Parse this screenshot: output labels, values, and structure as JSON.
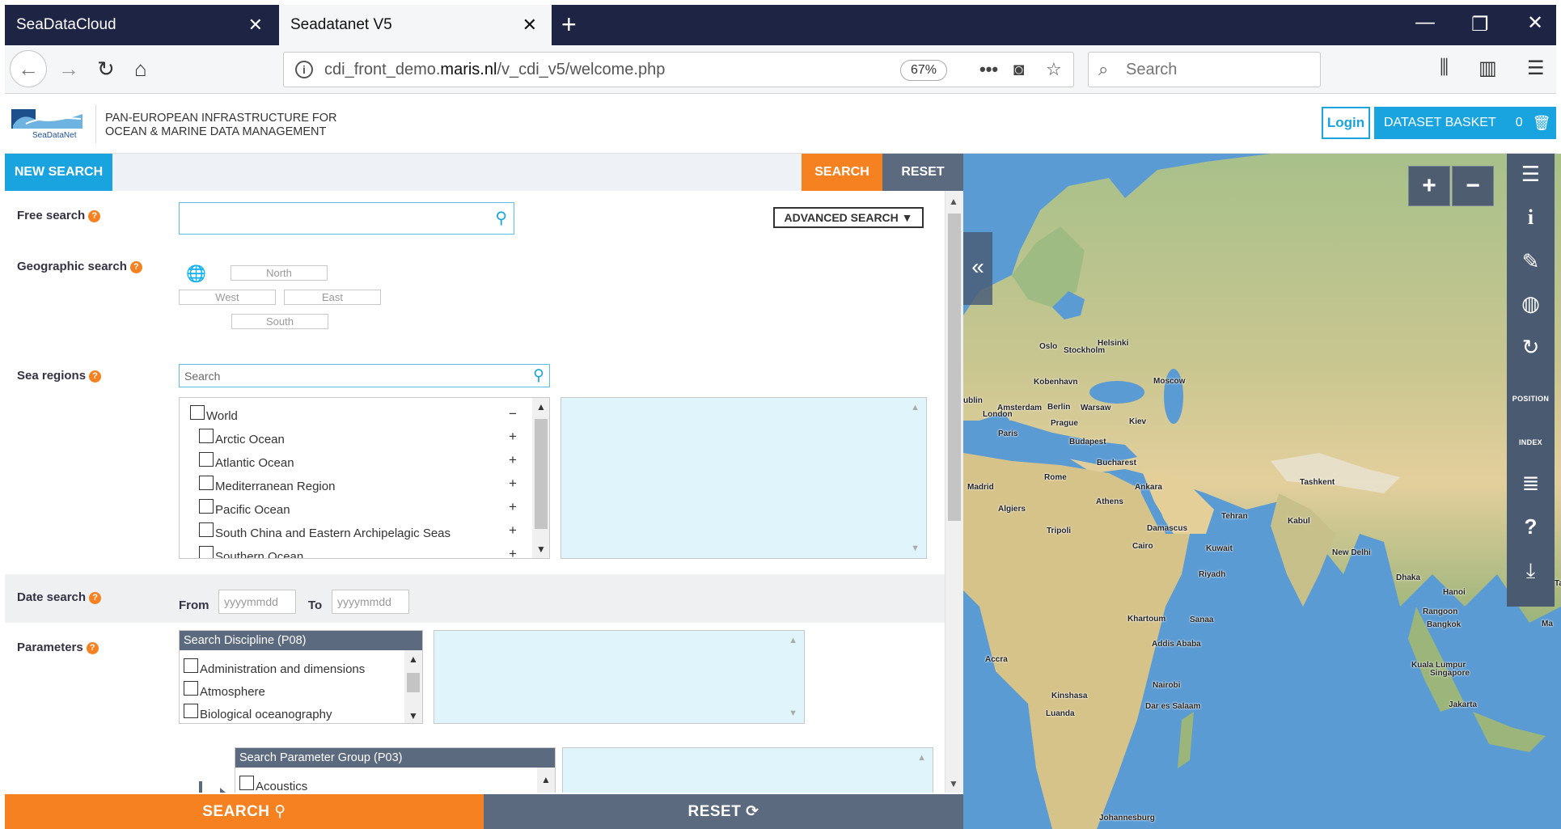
{
  "browser": {
    "tabs": [
      {
        "title": "SeaDataCloud"
      },
      {
        "title": "Seadatanet V5"
      }
    ],
    "url_prefix": "cdi_front_demo.",
    "url_domain": "maris.nl",
    "url_path": "/v_cdi_v5/welcome.php",
    "zoom": "67%",
    "search_placeholder": "Search"
  },
  "header": {
    "logo_text": "SeaDataNet",
    "tagline_line1": "PAN-EUROPEAN INFRASTRUCTURE FOR",
    "tagline_line2": "OCEAN & MARINE DATA MANAGEMENT",
    "login_label": "Login",
    "basket_label": "DATASET BASKET",
    "basket_count": "0"
  },
  "toolbar": {
    "new_search": "NEW SEARCH",
    "search": "SEARCH",
    "reset": "RESET"
  },
  "form": {
    "free_search_label": "Free search",
    "advanced_search": "ADVANCED SEARCH ▼",
    "geo_label": "Geographic search",
    "geo_north": "North",
    "geo_west": "West",
    "geo_east": "East",
    "geo_south": "South",
    "sea_label": "Sea regions",
    "sea_placeholder": "Search",
    "sea_regions": [
      {
        "label": "World",
        "toggle": "−"
      },
      {
        "label": "Arctic Ocean",
        "toggle": "+"
      },
      {
        "label": "Atlantic Ocean",
        "toggle": "+"
      },
      {
        "label": "Mediterranean Region",
        "toggle": "+"
      },
      {
        "label": "Pacific Ocean",
        "toggle": "+"
      },
      {
        "label": "South China and Eastern Archipelagic Seas",
        "toggle": "+"
      },
      {
        "label": "Southern Ocean",
        "toggle": "+"
      }
    ],
    "date_label": "Date search",
    "date_from": "From",
    "date_to": "To",
    "date_placeholder": "yyyymmdd",
    "params_label": "Parameters",
    "discipline_head": "Search Discipline (P08)",
    "disciplines": [
      "Administration and dimensions",
      "Atmosphere",
      "Biological oceanography"
    ],
    "group_head": "Search Parameter Group (P03)",
    "groups": [
      "Acoustics"
    ]
  },
  "bottom": {
    "search": "SEARCH",
    "reset": "RESET"
  },
  "map": {
    "zoom_in": "+",
    "zoom_out": "−",
    "tool_position": "POSITION",
    "tool_index": "INDEX",
    "cities": [
      "Oslo",
      "Stockholm",
      "Helsinki",
      "Kobenhavn",
      "Moscow",
      "ublin",
      "London",
      "Amsterdam",
      "Berlin",
      "Warsaw",
      "Paris",
      "Prague",
      "Kiev",
      "Budapest",
      "Bucharest",
      "Madrid",
      "Rome",
      "Ankara",
      "Tashkent",
      "Algiers",
      "Athens",
      "Tehran",
      "Kabul",
      "Tripoli",
      "Damascus",
      "Cairo",
      "Kuwait",
      "New Delhi",
      "Riyadh",
      "Dhaka",
      "Hanoi",
      "Khartoum",
      "Sanaa",
      "Rangoon",
      "Bangkok",
      "Addis Ababa",
      "Accra",
      "Kuala Lumpur",
      "Singapore",
      "Nairobi",
      "Kinshasa",
      "Dar es Salaam",
      "Jakarta",
      "Luanda",
      "Johannesburg",
      "Ma",
      "Ta"
    ]
  }
}
